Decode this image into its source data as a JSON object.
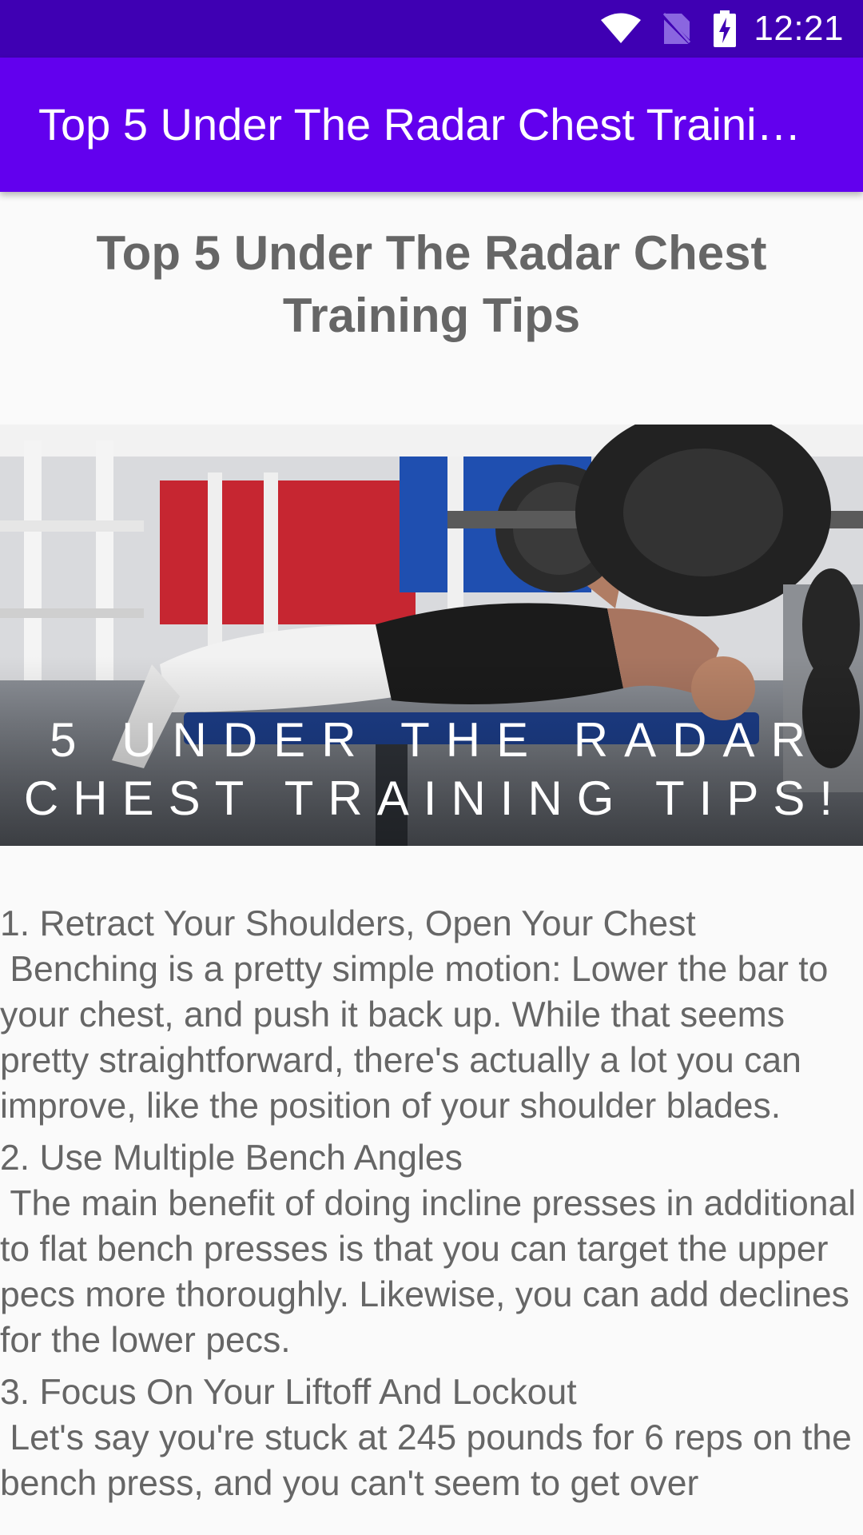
{
  "status_bar": {
    "time": "12:21",
    "icons": [
      "wifi-icon",
      "no-sim-icon",
      "battery-charging-icon"
    ],
    "color": "#3f00b3"
  },
  "app_bar": {
    "title": "Top 5 Under The Radar Chest Training Tips",
    "color": "#6200ee"
  },
  "article": {
    "title": "Top 5 Under The Radar Chest Training Tips",
    "image": {
      "caption_line1": "5 UNDER THE RADAR",
      "caption_line2": "CHEST TRAINING TIPS!"
    },
    "tips": [
      {
        "heading": "1. Retract Your Shoulders, Open Your Chest",
        "body": " Benching is a pretty simple motion: Lower the bar to your chest, and push it back up. While that seems pretty straightforward, there's actually a lot you can improve, like the position of your shoulder blades."
      },
      {
        "heading": "2. Use Multiple Bench Angles",
        "body": " The main benefit of doing incline presses in additional to flat bench presses is that you can target the upper pecs more thoroughly. Likewise, you can add declines for the lower pecs."
      },
      {
        "heading": "3. Focus On Your Liftoff And Lockout",
        "body": " Let's say you're stuck at 245 pounds for 6 reps on the bench press, and you can't seem to get over"
      }
    ]
  }
}
